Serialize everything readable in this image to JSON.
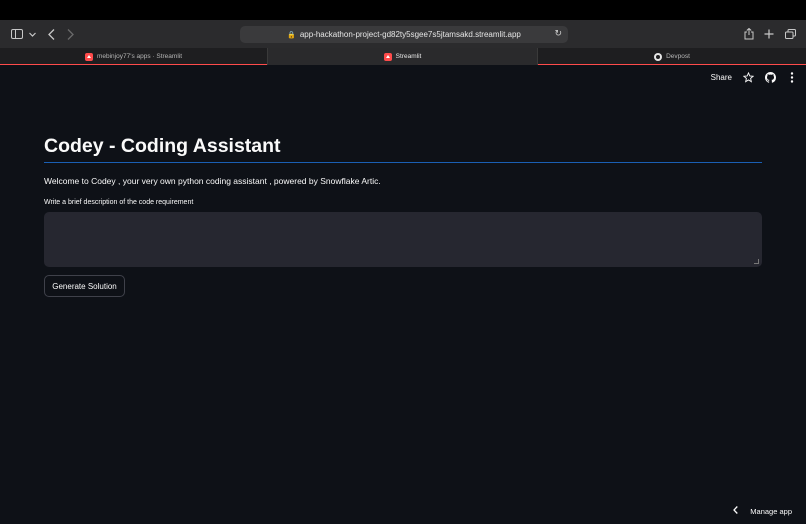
{
  "browser": {
    "url": "app-hackathon-project-gd82ty5sgee7s5jtamsakd.streamlit.app",
    "tabs": [
      {
        "label": "mebinjoy77's apps · Streamlit",
        "active": false
      },
      {
        "label": "Streamlit",
        "active": true
      },
      {
        "label": "Devpost",
        "active": false
      }
    ]
  },
  "app_header": {
    "share_label": "Share"
  },
  "main": {
    "title": "Codey - Coding Assistant",
    "welcome_text": "Welcome to Codey , your very own python coding assistant , powered by Snowflake Artic.",
    "input_label": "Write a brief description of the code requirement",
    "input_value": "",
    "button_label": "Generate Solution"
  },
  "footer": {
    "manage_label": "Manage app"
  },
  "colors": {
    "background": "#0e1117",
    "input_bg": "#262730",
    "divider": "#1a5fb4",
    "accent": "#ff4b4b"
  }
}
